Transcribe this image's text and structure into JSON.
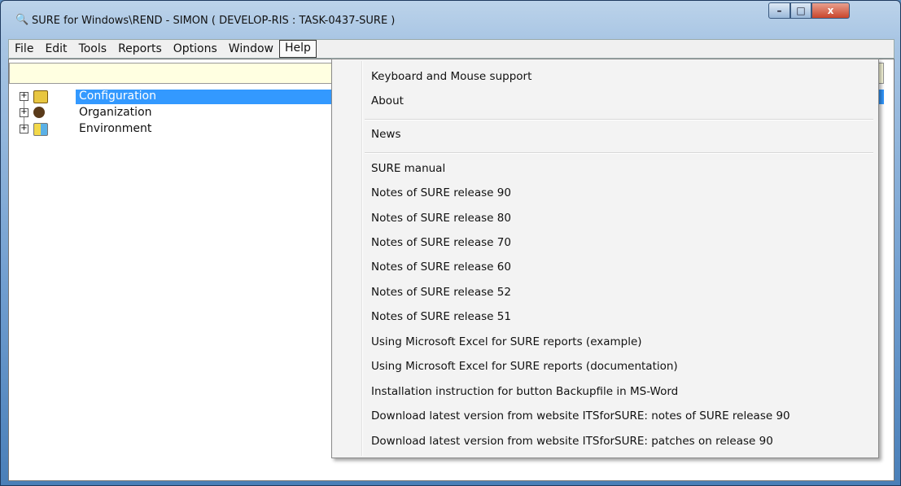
{
  "window": {
    "title": "SURE for Windows\\REND - SIMON ( DEVELOP-RIS : TASK-0437-SURE )",
    "app_icon": "binoculars-icon",
    "controls": {
      "minimize": "–",
      "maximize": "□",
      "close": "x"
    }
  },
  "menubar": {
    "items": [
      "File",
      "Edit",
      "Tools",
      "Reports",
      "Options",
      "Window",
      "Help"
    ],
    "active": "Help"
  },
  "tree": {
    "nodes": [
      {
        "label": "Configuration",
        "icon": "configuration-icon",
        "selected": true
      },
      {
        "label": "Organization",
        "icon": "organization-icon",
        "selected": false
      },
      {
        "label": "Environment",
        "icon": "environment-icon",
        "selected": false
      }
    ],
    "expander": "+"
  },
  "help_menu": {
    "groups": [
      [
        "Keyboard and Mouse support",
        "About"
      ],
      [
        "News"
      ],
      [
        "SURE manual",
        "Notes of SURE release 90",
        "Notes of SURE release 80",
        "Notes of SURE release 70",
        "Notes of SURE release 60",
        "Notes of SURE release 52",
        "Notes of SURE release 51",
        "Using Microsoft Excel for SURE reports (example)",
        "Using Microsoft Excel for SURE reports (documentation)",
        "Installation instruction for button Backupfile in MS-Word",
        "Download latest version from website ITSforSURE: notes of SURE release 90",
        "Download latest version from website ITSforSURE: patches on release 90"
      ]
    ]
  },
  "colors": {
    "selection": "#3399ff",
    "tooltip_bar": "#ffffe1",
    "close_button": "#c9462c"
  }
}
